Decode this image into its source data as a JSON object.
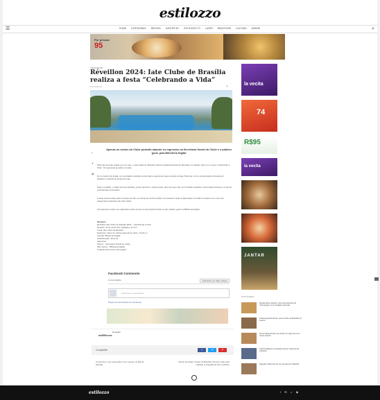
{
  "site": {
    "logo": "estilozzo"
  },
  "nav": {
    "items": [
      "Home",
      "Categorias",
      "Revista",
      "Gastrô DF",
      "Estilozzo.tv",
      "Lazer",
      "Bem-estar",
      "Cultura",
      "Assine"
    ]
  },
  "top_banner": {
    "price": "95",
    "price_note": "Por pessoa"
  },
  "article": {
    "breadcrumb": "Gastronomia",
    "title": "Réveillon 2024: Iate Clube de Brasília realiza a festa “Celebrando a Vida”",
    "meta": "Por Estilozzo",
    "lead": "Apenas os sócios do Clube poderão adquirir os ingressos na Secretaria Social do Clube e o público geral, pela Bilheteria Digital",
    "paragraphs": [
      "Para dar as boas-vindas ao novo ano, o Iate Clube de Brasília realiza a tradicional festa de Réveillon no sábado (31) com o tema “Celebrando a Vida”. Os ingressos já estão à venda.",
      "No momento da virada, os convidados poderão contemplar a queima de fogos à beira do lago Paranoá, com a programação animada por atrações musicais ao longo da noite.",
      "Para a ocasião, o buffet servirá entradas, pratos quentes e sobremesas, além de open bar com bebidas variadas. A decoração ficará por conta de profissionais renomados.",
      "A festa está prevista para começar às 21h e terminar às 4h da manhã. Os presentes terão à disposição um buffet completo com menu de categorias preparado pelo Iate Clube.",
      "Os ingressos podem ser adquiridos pelos sócios na Secretaria Social ou pelo público geral na Bilheteria Digital."
    ],
    "services_title": "Serviços",
    "services": [
      "Réveillon Iate Clube de Brasília 2024 – Celebrando a Vida",
      "Quando: 31 de dezembro (sábado), às 21h",
      "Local: Iate Clube de Brasília",
      "Endereço: Setor de Clubes Esportivos Norte, Trecho 2",
      "Vendas: Bilheteria Digital",
      "Classificação: 18 anos",
      "Ingressos:",
      "Sócios – Secretaria Social do Clube",
      "Não sócios – Bilheteria Digital",
      "Crianças até 6 anos não pagam"
    ]
  },
  "comments": {
    "title": "Facebook Comments",
    "count": "0 comentários",
    "sort_label": "Classificar por",
    "sort_value": "Mais antigos",
    "placeholder": "Adicione um comentário...",
    "plugin": "Plugin de comentários do Facebook"
  },
  "author": {
    "logo": "estilozzo",
    "name": "Redação"
  },
  "share": {
    "label": "Compartilhe"
  },
  "prevnext": {
    "prev": "Comemore o seu aniversário com a gente no Bar do Alemão",
    "next": "Tempo de Natal: Cortiço de Brasília promove noite para celebrar a chegada do bom velhinho"
  },
  "sidebar": {
    "ads": [
      {
        "text": "la vecita",
        "color": "#5a2a8c"
      },
      {
        "text": "74",
        "color": "#e24b2a"
      },
      {
        "text": "R$95",
        "color": "#2e8b3d"
      },
      {
        "text": "la vecita",
        "color": "#5a2a8c"
      }
    ],
    "jantar": "JANTAR"
  },
  "popular": {
    "title": "Populares",
    "items": [
      {
        "text": "Restaurante celebra o Dia Internacional do Champagne com cardápio especial"
      },
      {
        "text": "Festival gastronômico reúne chefs de Brasília em evento"
      },
      {
        "text": "Nova cafeteria abre as portas no Lago Sul com menu autoral"
      },
      {
        "text": "Chef brasiliense conquista prêmio nacional de culinária"
      },
      {
        "text": "Agenda cultural do fim de semana em Brasília"
      }
    ]
  },
  "footer": {
    "logo": "estilozzo",
    "social": "f ✉ ♫ ◉"
  }
}
